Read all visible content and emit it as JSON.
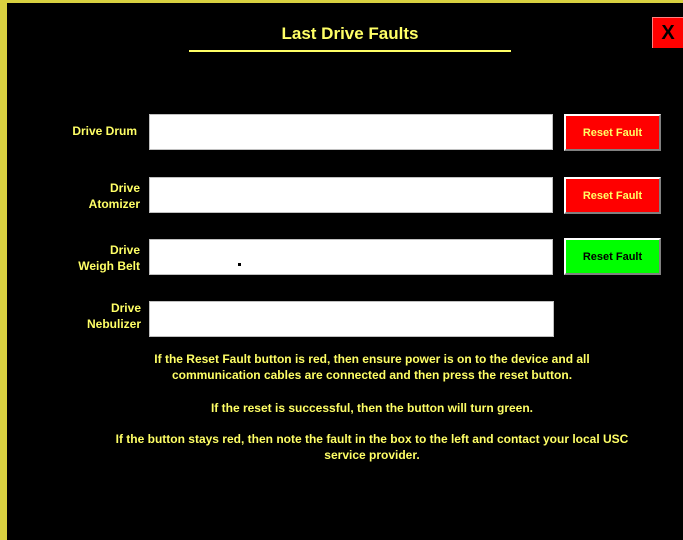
{
  "title": "Last Drive Faults",
  "close_label": "X",
  "drives": [
    {
      "label_line1": "Drive Drum",
      "label_line2": "",
      "value": "",
      "reset_label": "Reset Fault",
      "reset_state": "red"
    },
    {
      "label_line1": "Drive",
      "label_line2": "Atomizer",
      "value": "",
      "reset_label": "Reset Fault",
      "reset_state": "red"
    },
    {
      "label_line1": "Drive",
      "label_line2": "Weigh Belt",
      "value": "",
      "reset_label": "Reset Fault",
      "reset_state": "green"
    },
    {
      "label_line1": "Drive",
      "label_line2": "Nebulizer",
      "value": ""
    }
  ],
  "info": {
    "line1": "If the Reset Fault button is red, then ensure power is on to the device and all",
    "line2": "communication cables are connected and then press the reset button.",
    "line3": "If the reset is successful, then the button will turn green.",
    "line4": "If the button stays red, then note the fault  in the box to the left and contact your local USC",
    "line5": "service provider."
  },
  "colors": {
    "background": "#000000",
    "text": "#ffff66",
    "frame": "#d8d040",
    "reset_red": "#ff0000",
    "reset_green": "#00ff00",
    "close": "#ff0000"
  }
}
